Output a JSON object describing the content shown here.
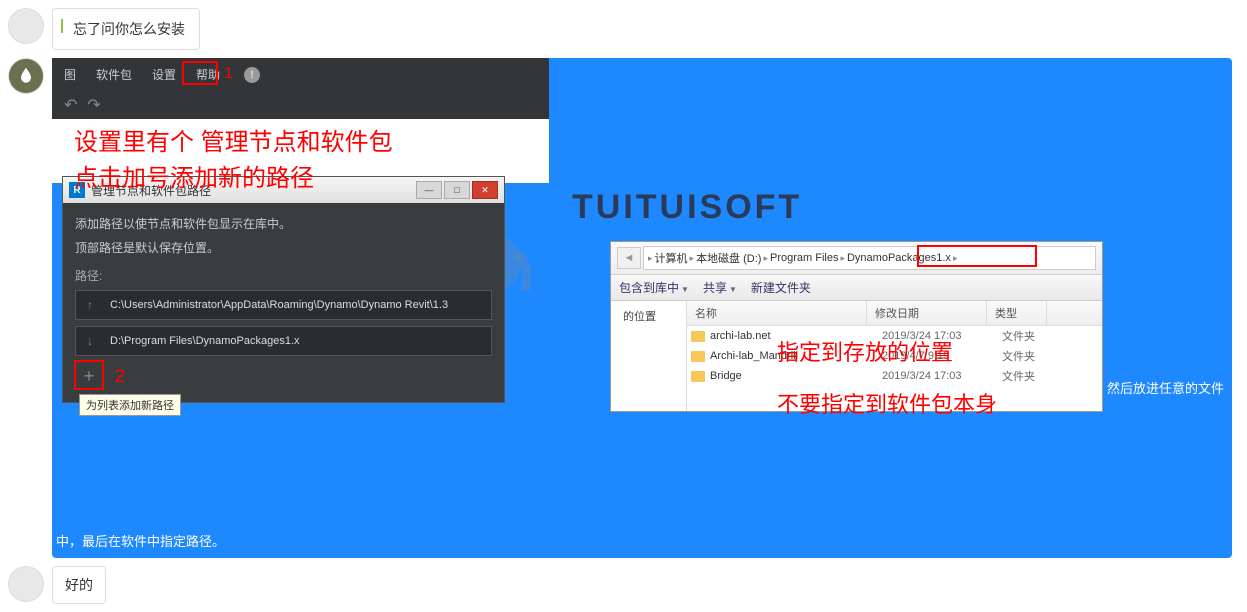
{
  "msg1": "忘了问你怎么安装",
  "msg3": "好的",
  "dynamo": {
    "menu": [
      "图",
      "软件包",
      "设置",
      "帮助"
    ],
    "annotation_1": "1",
    "overlay_line1": "设置里有个 管理节点和软件包",
    "overlay_line2": "点击加号添加新的路径",
    "dialog_title": "管理节点和软件包路径",
    "dialog_desc1": "添加路径以使节点和软件包显示在库中。",
    "dialog_desc2": "顶部路径是默认保存位置。",
    "path_label": "路径:",
    "path1": "C:\\Users\\Administrator\\AppData\\Roaming\\Dynamo\\Dynamo Revit\\1.3",
    "path2": "D:\\Program Files\\DynamoPackages1.x",
    "annotation_2": "2",
    "tooltip": "为列表添加新路径"
  },
  "watermark": {
    "text_en": "TUITUISOFT",
    "text_cn": "腿腿教学网"
  },
  "explorer": {
    "breadcrumb": [
      "计算机",
      "本地磁盘 (D:)",
      "Program Files",
      "DynamoPackages1.x"
    ],
    "toolbar": {
      "include": "包含到库中",
      "share": "共享",
      "new_folder": "新建文件夹"
    },
    "side_item": "的位置",
    "cols": {
      "name": "名称",
      "date": "修改日期",
      "type": "类型"
    },
    "rows": [
      {
        "name": "archi-lab.net",
        "date": "2019/3/24 17:03",
        "type": "文件夹"
      },
      {
        "name": "Archi-lab_Mandrill",
        "date": "2019/4/7 9:19",
        "type": "文件夹"
      },
      {
        "name": "Bridge",
        "date": "2019/3/24 17:03",
        "type": "文件夹"
      }
    ],
    "overlay1": "指定到存放的位置",
    "overlay2": "不要指定到软件包本身"
  },
  "footer": {
    "pretext": "新解压软件包，然后放进任意的文件",
    "text": "中，最后在软件中指定路径。"
  }
}
